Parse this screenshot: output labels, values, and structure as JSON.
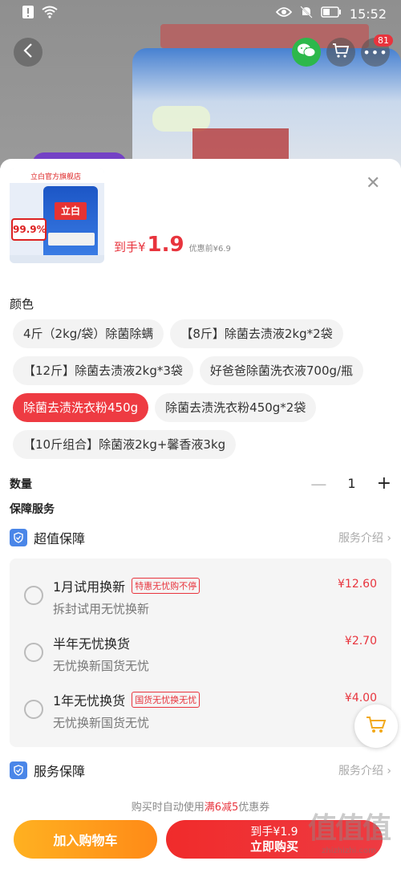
{
  "status_bar": {
    "time": "15:52"
  },
  "top_nav": {
    "cart_badge": "81"
  },
  "product": {
    "thumb_store_label": "立白官方旗舰店",
    "thumb_brand_text": "立白",
    "thumb_rate_text": "99.9%",
    "price_label": "到手¥",
    "price_value": "1.9",
    "original_price": "优惠前¥6.9"
  },
  "color_section": {
    "title": "颜色",
    "options": [
      {
        "label": "4斤（2kg/袋）除菌除螨",
        "selected": false
      },
      {
        "label": "【8斤】除菌去渍液2kg*2袋",
        "selected": false
      },
      {
        "label": "【12斤】除菌去渍液2kg*3袋",
        "selected": false
      },
      {
        "label": "好爸爸除菌洗衣液700g/瓶",
        "selected": false
      },
      {
        "label": "除菌去渍洗衣粉450g",
        "selected": true
      },
      {
        "label": "除菌去渍洗衣粉450g*2袋",
        "selected": false
      },
      {
        "label": "【10斤组合】除菌液2kg+馨香液3kg",
        "selected": false
      }
    ]
  },
  "quantity": {
    "label": "数量",
    "value": "1"
  },
  "guarantee": {
    "title": "保障服务",
    "premium": {
      "label": "超值保障",
      "link": "服务介绍"
    },
    "options": [
      {
        "title": "1月试用换新",
        "tag": "特惠无忧购不停",
        "subtitle": "拆封试用无忧换新",
        "price": "¥12.60"
      },
      {
        "title": "半年无忧换货",
        "tag": "",
        "subtitle": "无忧换新国货无忧",
        "price": "¥2.70"
      },
      {
        "title": "1年无忧换货",
        "tag": "国货无忧换无忧",
        "subtitle": "无忧换新国货无忧",
        "price": "¥4.00"
      }
    ],
    "service": {
      "label": "服务保障",
      "link": "服务介绍"
    }
  },
  "footer": {
    "coupon_prefix": "购买时自动使用",
    "coupon_highlight": "满6减5",
    "coupon_suffix": "优惠券",
    "add_to_cart": "加入购物车",
    "buy_price": "到手¥1.9",
    "buy_now": "立即购买"
  },
  "watermark": {
    "glyphs": "值值值",
    "url": "zhizhizhi.com"
  },
  "colors": {
    "accent": "#ee3b42",
    "cart_button": "#ff9a1c",
    "shield": "#4a86e8"
  }
}
